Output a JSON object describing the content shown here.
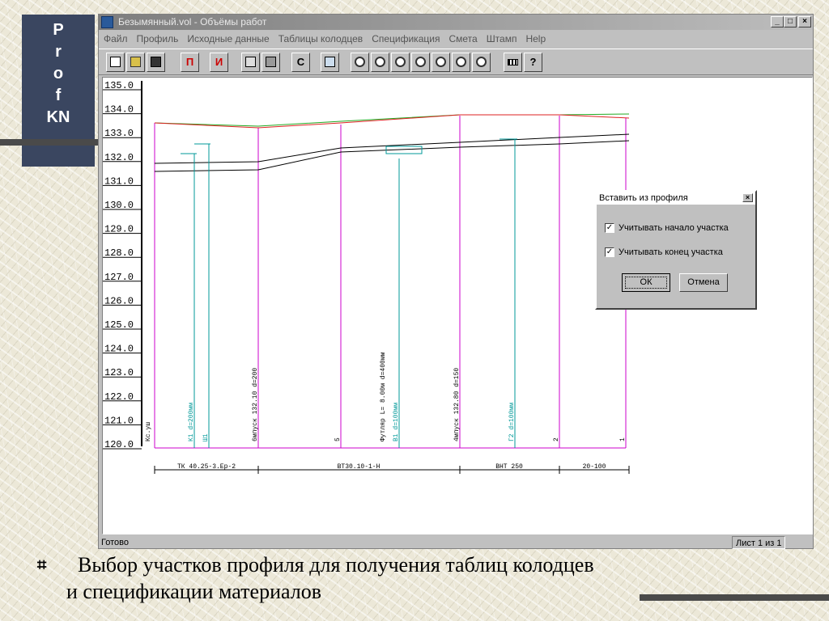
{
  "slide": {
    "logo_letters": [
      "P",
      "r",
      "o",
      "f",
      "KN"
    ],
    "bullet_symbol": "⌗",
    "caption_line1": "Выбор участков профиля для получения таблиц колодцев",
    "caption_line2": "и спецификации материалов"
  },
  "window": {
    "title": "Безымянный.vol - Объёмы работ",
    "btn_minimize": "_",
    "btn_maximize": "□",
    "btn_close": "×"
  },
  "menu": [
    "Файл",
    "Профиль",
    "Исходные данные",
    "Таблицы колодцев",
    "Спецификация",
    "Смета",
    "Штамп",
    "Help"
  ],
  "toolbar": {
    "p_label": "П",
    "i_label": "И",
    "c_label": "С",
    "help_label": "?"
  },
  "status": {
    "left": "Готово",
    "right": "Лист 1 из 1"
  },
  "profile": {
    "elevation_labels": [
      "135.0",
      "134.0",
      "133.0",
      "132.0",
      "131.0",
      "130.0",
      "129.0",
      "128.0",
      "127.0",
      "126.0",
      "125.0",
      "124.0",
      "123.0",
      "122.0",
      "121.0",
      "120.0"
    ],
    "vertical_labels": [
      "Кс.уш",
      "К1 d=200мм",
      "Ш1",
      "6мпуск 132.10 d=200",
      "5",
      "Футляр L= 8.00м d=400мм",
      "В1 d=100мм",
      "4мпуск 132.80 d=150",
      "Г2 d=100мм",
      "2",
      "1"
    ],
    "sections": [
      "ТК 40.25-3.Ер-2",
      "ВТ30.10-1-Н",
      "ВНТ 250",
      "20-100"
    ],
    "colors": {
      "ground_line": "#22aa22",
      "design_line": "#dd2222",
      "pipe_line": "#000000",
      "vertical_line": "#cc00cc",
      "well_line": "#009999",
      "grid_axis": "#000000"
    }
  },
  "dialog": {
    "title": "Вставить из профиля",
    "close": "×",
    "check1_label": "Учитывать начало  участка",
    "check2_label": "Учитывать конец  участка",
    "check_mark": "✓",
    "ok_label": "ОК",
    "cancel_label": "Отмена"
  }
}
